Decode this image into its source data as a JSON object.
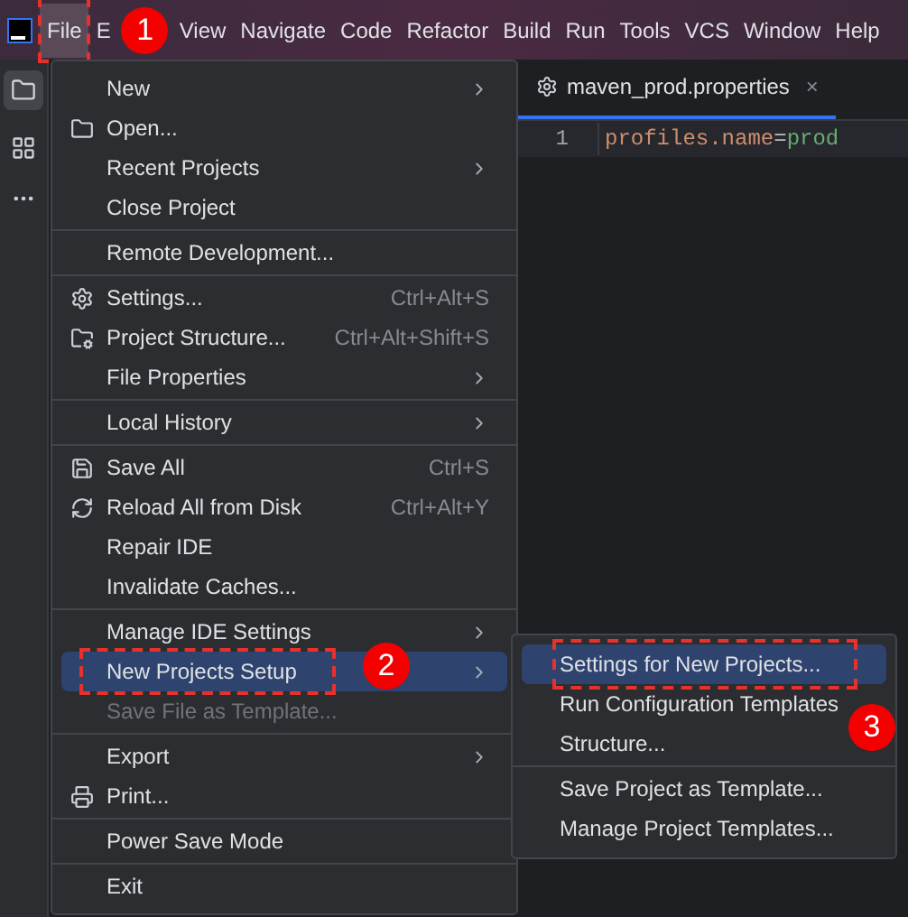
{
  "menubar": {
    "items": [
      {
        "label": "File",
        "selected": true,
        "marked": true
      },
      {
        "label": "E",
        "selected": false,
        "marked": false
      },
      {
        "label": "View",
        "selected": false,
        "marked": false
      },
      {
        "label": "Navigate",
        "selected": false,
        "marked": false
      },
      {
        "label": "Code",
        "selected": false,
        "marked": false
      },
      {
        "label": "Refactor",
        "selected": false,
        "marked": false
      },
      {
        "label": "Build",
        "selected": false,
        "marked": false
      },
      {
        "label": "Run",
        "selected": false,
        "marked": false
      },
      {
        "label": "Tools",
        "selected": false,
        "marked": false
      },
      {
        "label": "VCS",
        "selected": false,
        "marked": false
      },
      {
        "label": "Window",
        "selected": false,
        "marked": false
      },
      {
        "label": "Help",
        "selected": false,
        "marked": false
      }
    ]
  },
  "editor": {
    "tab": {
      "label": "maven_prod.properties",
      "close": "×"
    },
    "lines": [
      {
        "number": "1",
        "key": "profiles.name",
        "separator": "=",
        "value": "prod"
      }
    ]
  },
  "file_menu": {
    "items": [
      {
        "kind": "item",
        "label": "New",
        "submenu": true,
        "selected": false,
        "disabled": false,
        "marked": false
      },
      {
        "kind": "item",
        "label": "Open...",
        "selected": false,
        "disabled": false,
        "marked": false
      },
      {
        "kind": "item",
        "label": "Recent Projects",
        "submenu": true,
        "selected": false,
        "disabled": false,
        "marked": false
      },
      {
        "kind": "item",
        "label": "Close Project",
        "selected": false,
        "disabled": false,
        "marked": false
      },
      {
        "kind": "separator"
      },
      {
        "kind": "item",
        "label": "Remote Development...",
        "selected": false,
        "disabled": false,
        "marked": false
      },
      {
        "kind": "separator"
      },
      {
        "kind": "item",
        "label": "Settings...",
        "shortcut": "Ctrl+Alt+S",
        "selected": false,
        "disabled": false,
        "marked": false
      },
      {
        "kind": "item",
        "label": "Project Structure...",
        "shortcut": "Ctrl+Alt+Shift+S",
        "selected": false,
        "disabled": false,
        "marked": false
      },
      {
        "kind": "item",
        "label": "File Properties",
        "submenu": true,
        "selected": false,
        "disabled": false,
        "marked": false
      },
      {
        "kind": "separator"
      },
      {
        "kind": "item",
        "label": "Local History",
        "submenu": true,
        "selected": false,
        "disabled": false,
        "marked": false
      },
      {
        "kind": "separator"
      },
      {
        "kind": "item",
        "label": "Save All",
        "shortcut": "Ctrl+S",
        "selected": false,
        "disabled": false,
        "marked": false
      },
      {
        "kind": "item",
        "label": "Reload All from Disk",
        "shortcut": "Ctrl+Alt+Y",
        "selected": false,
        "disabled": false,
        "marked": false
      },
      {
        "kind": "item",
        "label": "Repair IDE",
        "selected": false,
        "disabled": false,
        "marked": false
      },
      {
        "kind": "item",
        "label": "Invalidate Caches...",
        "selected": false,
        "disabled": false,
        "marked": false
      },
      {
        "kind": "separator"
      },
      {
        "kind": "item",
        "label": "Manage IDE Settings",
        "submenu": true,
        "selected": false,
        "disabled": false,
        "marked": false
      },
      {
        "kind": "item",
        "label": "New Projects Setup",
        "submenu": true,
        "selected": true,
        "disabled": false,
        "marked": true
      },
      {
        "kind": "item",
        "label": "Save File as Template...",
        "selected": false,
        "disabled": true,
        "marked": false
      },
      {
        "kind": "separator"
      },
      {
        "kind": "item",
        "label": "Export",
        "submenu": true,
        "selected": false,
        "disabled": false,
        "marked": false
      },
      {
        "kind": "item",
        "label": "Print...",
        "selected": false,
        "disabled": false,
        "marked": false
      },
      {
        "kind": "separator"
      },
      {
        "kind": "item",
        "label": "Power Save Mode",
        "selected": false,
        "disabled": false,
        "marked": false
      },
      {
        "kind": "separator"
      },
      {
        "kind": "item",
        "label": "Exit",
        "selected": false,
        "disabled": false,
        "marked": false
      }
    ]
  },
  "submenu": {
    "items": [
      {
        "kind": "item",
        "label": "Settings for New Projects...",
        "selected": true,
        "marked": true
      },
      {
        "kind": "item",
        "label": "Run Configuration Templates",
        "selected": false,
        "marked": false
      },
      {
        "kind": "item",
        "label": "Structure...",
        "selected": false,
        "marked": false
      },
      {
        "kind": "separator"
      },
      {
        "kind": "item",
        "label": "Save Project as Template...",
        "selected": false,
        "marked": false
      },
      {
        "kind": "item",
        "label": "Manage Project Templates...",
        "selected": false,
        "marked": false
      }
    ]
  },
  "annotations": [
    {
      "label": "1"
    },
    {
      "label": "2"
    },
    {
      "label": "3"
    }
  ]
}
